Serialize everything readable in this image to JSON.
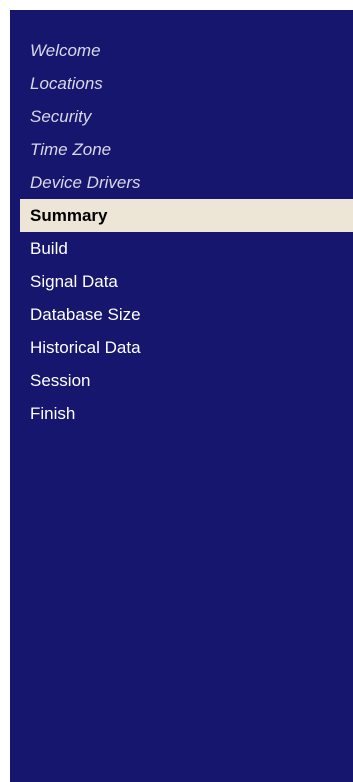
{
  "wizard_steps": {
    "items": [
      {
        "label": "Welcome",
        "state": "done"
      },
      {
        "label": "Locations",
        "state": "done"
      },
      {
        "label": "Security",
        "state": "done"
      },
      {
        "label": "Time Zone",
        "state": "done"
      },
      {
        "label": "Device Drivers",
        "state": "done"
      },
      {
        "label": "Summary",
        "state": "current"
      },
      {
        "label": "Build",
        "state": "pending"
      },
      {
        "label": "Signal Data",
        "state": "pending"
      },
      {
        "label": "Database Size",
        "state": "pending"
      },
      {
        "label": "Historical Data",
        "state": "pending"
      },
      {
        "label": "Session",
        "state": "pending"
      },
      {
        "label": "Finish",
        "state": "pending"
      }
    ]
  },
  "colors": {
    "panel_background": "#16166e",
    "current_highlight": "#ede6d6",
    "text": "#ffffff"
  }
}
